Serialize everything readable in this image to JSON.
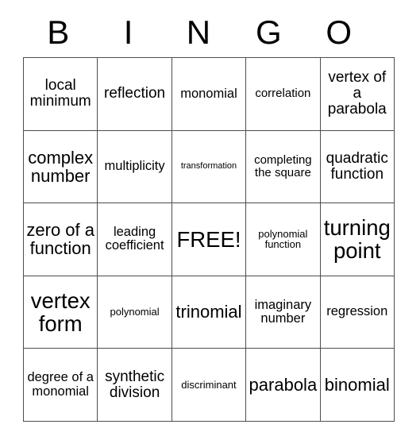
{
  "card": {
    "title": "BINGO",
    "header_letters": [
      "B",
      "I",
      "N",
      "G",
      "O"
    ],
    "free_space_label": "FREE!",
    "colors": {
      "background": "#ffffff",
      "text": "#000000",
      "grid_line": "#4d4d4d"
    },
    "rows": [
      [
        {
          "text": "local minimum",
          "size": "fs-xl"
        },
        {
          "text": "reflection",
          "size": "fs-xl"
        },
        {
          "text": "monomial",
          "size": "fs-lg"
        },
        {
          "text": "correlation",
          "size": "fs-md"
        },
        {
          "text": "vertex of a parabola",
          "size": "fs-xl"
        }
      ],
      [
        {
          "text": "complex number",
          "size": "fs-xxl"
        },
        {
          "text": "multiplicity",
          "size": "fs-lg"
        },
        {
          "text": "transformation",
          "size": "fs-xs"
        },
        {
          "text": "completing the square",
          "size": "fs-md"
        },
        {
          "text": "quadratic function",
          "size": "fs-xl"
        }
      ],
      [
        {
          "text": "zero of a function",
          "size": "fs-xxl"
        },
        {
          "text": "leading coefficient",
          "size": "fs-lg"
        },
        {
          "text": "FREE!",
          "size": "fs-huge"
        },
        {
          "text": "polynomial function",
          "size": "fs-sm"
        },
        {
          "text": "turning point",
          "size": "fs-huge"
        }
      ],
      [
        {
          "text": "vertex form",
          "size": "fs-huge"
        },
        {
          "text": "polynomial",
          "size": "fs-sm"
        },
        {
          "text": "trinomial",
          "size": "fs-xxl"
        },
        {
          "text": "imaginary number",
          "size": "fs-lg"
        },
        {
          "text": "regression",
          "size": "fs-lg"
        }
      ],
      [
        {
          "text": "degree of a monomial",
          "size": "fs-lg"
        },
        {
          "text": "synthetic division",
          "size": "fs-xl"
        },
        {
          "text": "discriminant",
          "size": "fs-sm"
        },
        {
          "text": "parabola",
          "size": "fs-xxl"
        },
        {
          "text": "binomial",
          "size": "fs-xxl"
        }
      ]
    ]
  }
}
